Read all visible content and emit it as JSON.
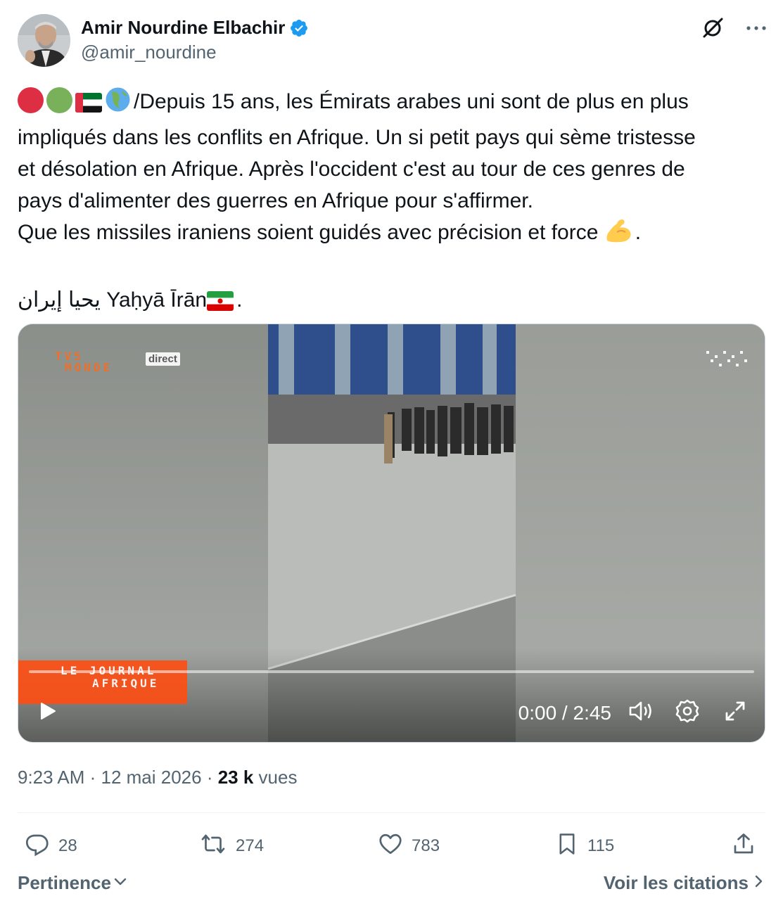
{
  "author": {
    "display_name": "Amir Nourdine Elbachir",
    "handle": "@amir_nourdine",
    "verified": true
  },
  "tweet": {
    "line1": "/Depuis 15 ans, les Émirats arabes uni sont de plus en plus",
    "line2": "impliqués dans les conflits en Afrique. Un si petit pays qui sème tristesse",
    "line3": "et désolation en Afrique. Après l'occident c'est au tour de ces genres de",
    "line4": "pays d'alimenter des guerres en Afrique pour s'affirmer.",
    "line5": "Que les missiles iraniens soient guidés avec précision et force",
    "line5_end": ".",
    "line6_arabic": "يحيا إيران",
    "line6_latin": " Yaḥyā Īrān",
    "line6_end": "."
  },
  "video": {
    "time": "0:00 / 2:45",
    "overlay_logo_line1": "TV5",
    "overlay_logo_line2": "MONDE",
    "overlay_badge": "direct",
    "banner_line1": "LE JOURNAL",
    "banner_line2": "AFRIQUE",
    "progress": 0
  },
  "meta": {
    "time": "9:23 AM · 12 mai 2026 · ",
    "views_count": "23 k",
    "views_label": " vues"
  },
  "actions": {
    "replies": "28",
    "reposts": "274",
    "likes": "783",
    "bookmarks": "115"
  },
  "footer": {
    "sort_label": "Pertinence",
    "quotes_label": "Voir les citations"
  },
  "colors": {
    "text_primary": "#0f1419",
    "text_secondary": "#536471",
    "verified_blue": "#1d9bf0",
    "divider": "#eff3f4"
  },
  "icons": [
    "grok-icon",
    "more-icon",
    "verified-badge-icon",
    "play-icon",
    "volume-icon",
    "settings-icon",
    "fullscreen-icon",
    "reply-icon",
    "repost-icon",
    "like-icon",
    "bookmark-icon",
    "share-icon",
    "chevron-down-icon",
    "chevron-right-icon"
  ]
}
